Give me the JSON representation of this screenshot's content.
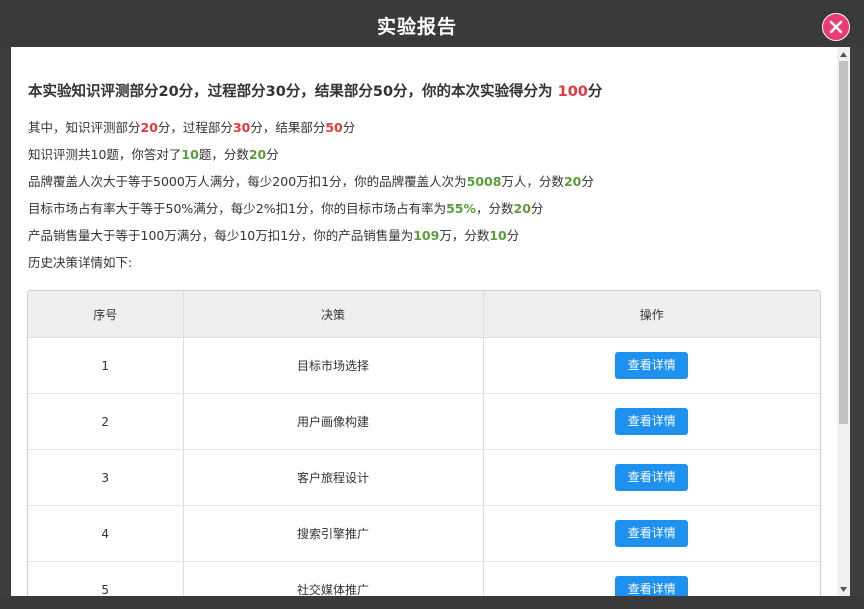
{
  "dialog": {
    "title": "实验报告"
  },
  "summary": {
    "text": "本实验知识评测部分20分，过程部分30分，结果部分50分，你的本次实验得分为",
    "score": "100",
    "unit": "分"
  },
  "lines": {
    "l1": {
      "a": "其中，知识评测部分",
      "v1": "20",
      "b": "分，过程部分",
      "v2": "30",
      "c": "分，结果部分",
      "v3": "50",
      "d": "分"
    },
    "l2": {
      "a": "知识评测共10题，你答对了",
      "v1": "10",
      "b": "题，分数",
      "v2": "20",
      "c": "分"
    },
    "l3": {
      "a": "品牌覆盖人次大于等于5000万人满分，每少200万扣1分，你的品牌覆盖人次为",
      "v1": "5008",
      "b": "万人，分数",
      "v2": "20",
      "c": "分"
    },
    "l4": {
      "a": "目标市场占有率大于等于50%满分，每少2%扣1分，你的目标市场占有率为",
      "v1": "55%",
      "b": "，分数",
      "v2": "20",
      "c": "分"
    },
    "l5": {
      "a": "产品销售量大于等于100万满分，每少10万扣1分，你的产品销售量为",
      "v1": "109",
      "b": "万，分数",
      "v2": "10",
      "c": "分"
    },
    "l6": {
      "a": "历史决策详情如下:"
    }
  },
  "table": {
    "headers": [
      "序号",
      "决策",
      "操作"
    ],
    "rows": [
      {
        "num": "1",
        "decision": "目标市场选择",
        "action": "查看详情"
      },
      {
        "num": "2",
        "decision": "用户画像构建",
        "action": "查看详情"
      },
      {
        "num": "3",
        "decision": "客户旅程设计",
        "action": "查看详情"
      },
      {
        "num": "4",
        "decision": "搜索引擎推广",
        "action": "查看详情"
      },
      {
        "num": "5",
        "decision": "社交媒体推广",
        "action": "查看详情"
      }
    ]
  },
  "icons": {
    "close": "close-icon",
    "scroll_up": "arrow-up-icon",
    "scroll_down": "arrow-down-icon"
  },
  "colors": {
    "highlight_red": "#e4393c",
    "highlight_green": "#5a9e3a",
    "button_blue": "#1e90f0",
    "close_pink": "#ee3b77"
  }
}
